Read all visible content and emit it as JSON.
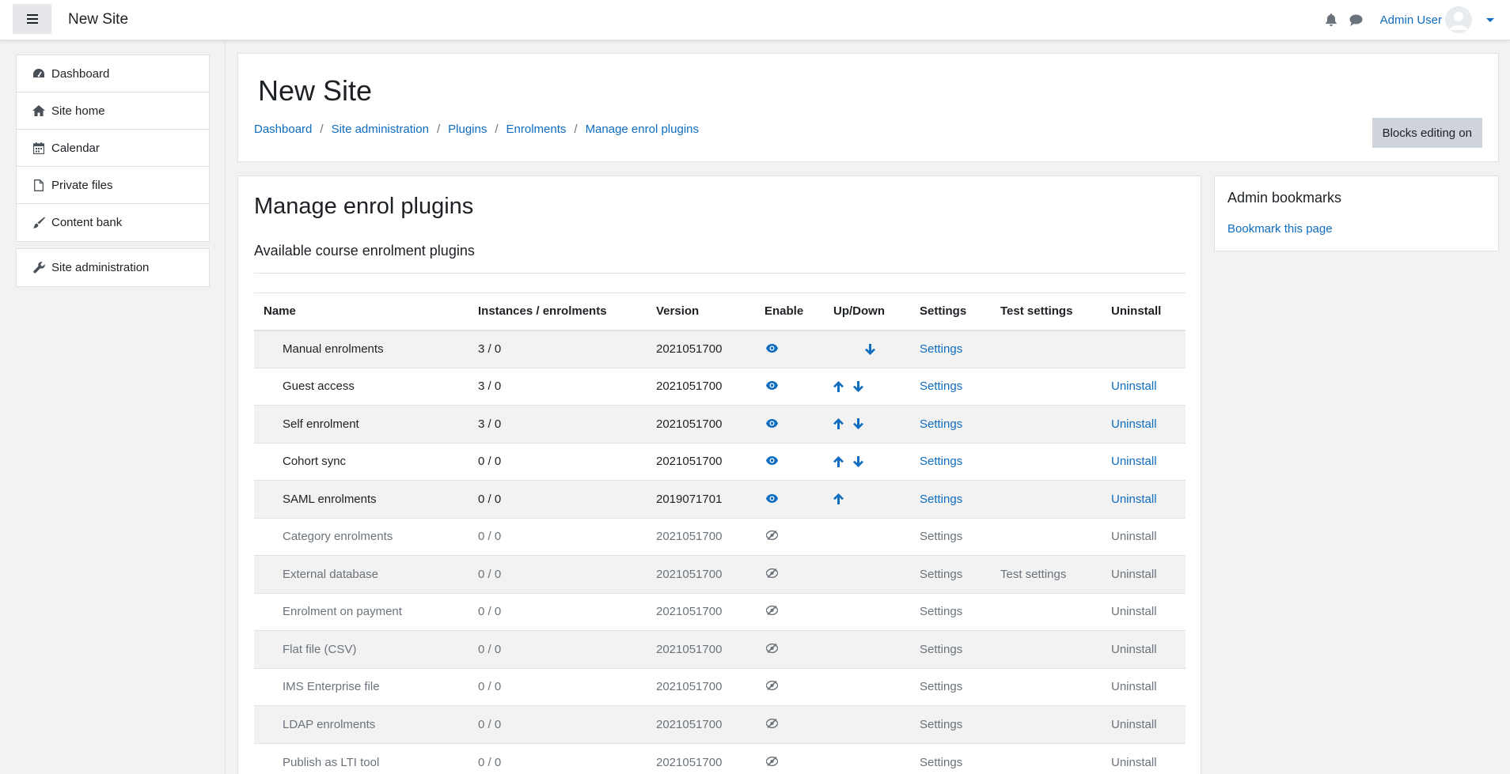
{
  "navbar": {
    "site_name": "New Site",
    "user_name": "Admin User",
    "icons": [
      "menu-icon",
      "bell-icon",
      "chat-icon",
      "avatar",
      "caret-down-icon"
    ]
  },
  "drawer": {
    "items": [
      {
        "label": "Dashboard",
        "icon": "dashboard-icon"
      },
      {
        "label": "Site home",
        "icon": "home-icon"
      },
      {
        "label": "Calendar",
        "icon": "calendar-icon"
      },
      {
        "label": "Private files",
        "icon": "file-icon"
      },
      {
        "label": "Content bank",
        "icon": "brush-icon"
      }
    ],
    "admin_item": {
      "label": "Site administration",
      "icon": "wrench-icon"
    }
  },
  "header": {
    "title": "New Site",
    "breadcrumb": [
      "Dashboard",
      "Site administration",
      "Plugins",
      "Enrolments",
      "Manage enrol plugins"
    ],
    "blocks_button": "Blocks editing on"
  },
  "main": {
    "title": "Manage enrol plugins",
    "subtitle": "Available course enrolment plugins",
    "columns": [
      "Name",
      "Instances / enrolments",
      "Version",
      "Enable",
      "Up/Down",
      "Settings",
      "Test settings",
      "Uninstall"
    ],
    "rows": [
      {
        "name": "Manual enrolments",
        "instances": "3 / 0",
        "version": "2021051700",
        "enabled": true,
        "up": false,
        "down": true,
        "settings": "Settings",
        "test": "",
        "uninstall": ""
      },
      {
        "name": "Guest access",
        "instances": "3 / 0",
        "version": "2021051700",
        "enabled": true,
        "up": true,
        "down": true,
        "settings": "Settings",
        "test": "",
        "uninstall": "Uninstall"
      },
      {
        "name": "Self enrolment",
        "instances": "3 / 0",
        "version": "2021051700",
        "enabled": true,
        "up": true,
        "down": true,
        "settings": "Settings",
        "test": "",
        "uninstall": "Uninstall"
      },
      {
        "name": "Cohort sync",
        "instances": "0 / 0",
        "version": "2021051700",
        "enabled": true,
        "up": true,
        "down": true,
        "settings": "Settings",
        "test": "",
        "uninstall": "Uninstall"
      },
      {
        "name": "SAML enrolments",
        "instances": "0 / 0",
        "version": "2019071701",
        "enabled": true,
        "up": true,
        "down": false,
        "settings": "Settings",
        "test": "",
        "uninstall": "Uninstall"
      },
      {
        "name": "Category enrolments",
        "instances": "0 / 0",
        "version": "2021051700",
        "enabled": false,
        "up": false,
        "down": false,
        "settings": "Settings",
        "test": "",
        "uninstall": "Uninstall"
      },
      {
        "name": "External database",
        "instances": "0 / 0",
        "version": "2021051700",
        "enabled": false,
        "up": false,
        "down": false,
        "settings": "Settings",
        "test": "Test settings",
        "uninstall": "Uninstall"
      },
      {
        "name": "Enrolment on payment",
        "instances": "0 / 0",
        "version": "2021051700",
        "enabled": false,
        "up": false,
        "down": false,
        "settings": "Settings",
        "test": "",
        "uninstall": "Uninstall"
      },
      {
        "name": "Flat file (CSV)",
        "instances": "0 / 0",
        "version": "2021051700",
        "enabled": false,
        "up": false,
        "down": false,
        "settings": "Settings",
        "test": "",
        "uninstall": "Uninstall"
      },
      {
        "name": "IMS Enterprise file",
        "instances": "0 / 0",
        "version": "2021051700",
        "enabled": false,
        "up": false,
        "down": false,
        "settings": "Settings",
        "test": "",
        "uninstall": "Uninstall"
      },
      {
        "name": "LDAP enrolments",
        "instances": "0 / 0",
        "version": "2021051700",
        "enabled": false,
        "up": false,
        "down": false,
        "settings": "Settings",
        "test": "",
        "uninstall": "Uninstall"
      },
      {
        "name": "Publish as LTI tool",
        "instances": "0 / 0",
        "version": "2021051700",
        "enabled": false,
        "up": false,
        "down": false,
        "settings": "Settings",
        "test": "",
        "uninstall": "Uninstall"
      }
    ]
  },
  "block": {
    "title": "Admin bookmarks",
    "link": "Bookmark this page"
  },
  "colors": {
    "link": "#0f6cbf",
    "muted": "#6a737b",
    "button_bg": "#ced4da",
    "stripe": "#f2f2f2"
  }
}
